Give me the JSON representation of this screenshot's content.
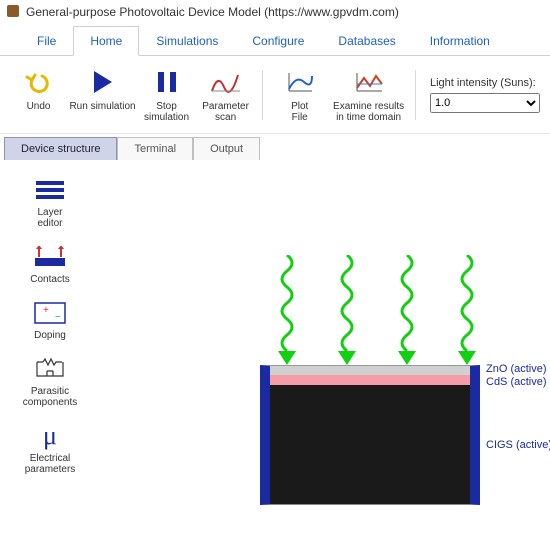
{
  "window": {
    "title": "General-purpose Photovoltaic Device Model (https://www.gpvdm.com)"
  },
  "menubar": {
    "items": [
      {
        "label": "File"
      },
      {
        "label": "Home"
      },
      {
        "label": "Simulations"
      },
      {
        "label": "Configure"
      },
      {
        "label": "Databases"
      },
      {
        "label": "Information"
      }
    ],
    "active_index": 1
  },
  "ribbon": {
    "undo": "Undo",
    "run": "Run simulation",
    "stop": "Stop\nsimulation",
    "scan": "Parameter\nscan",
    "plot": "Plot\nFile",
    "examine": "Examine results\nin time domain",
    "light_label": "Light intensity (Suns):",
    "light_value": "1.0"
  },
  "subtabs": {
    "items": [
      {
        "label": "Device structure"
      },
      {
        "label": "Terminal"
      },
      {
        "label": "Output"
      }
    ],
    "active_index": 0
  },
  "sidebar": {
    "items": [
      {
        "id": "layer-editor",
        "label": "Layer\neditor"
      },
      {
        "id": "contacts",
        "label": "Contacts"
      },
      {
        "id": "doping",
        "label": "Doping"
      },
      {
        "id": "parasitic",
        "label": "Parasitic\ncomponents"
      },
      {
        "id": "electrical",
        "label": "Electrical\nparameters"
      }
    ]
  },
  "device": {
    "layers": [
      {
        "name": "ZnO (active)"
      },
      {
        "name": "CdS (active)"
      },
      {
        "name": "CIGS (active)"
      }
    ]
  }
}
